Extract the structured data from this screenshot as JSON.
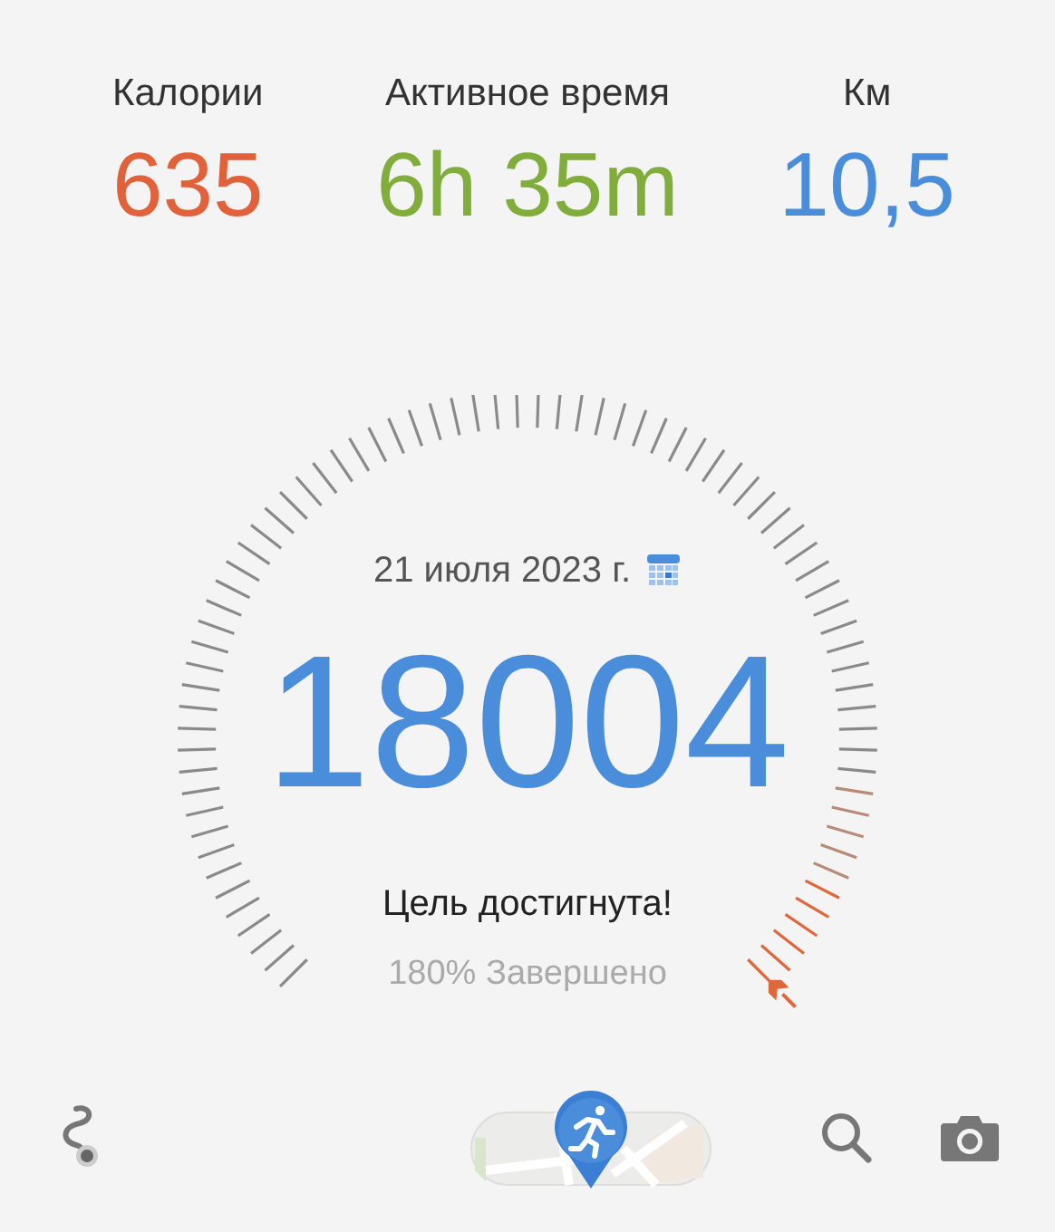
{
  "stats": [
    {
      "label": "Калории",
      "value": "635",
      "color": "#e1613b"
    },
    {
      "label": "Активное время",
      "value": "6h 35m",
      "color": "#80ad3c"
    },
    {
      "label": "Км",
      "value": "10,5",
      "color": "#4a8ddb"
    }
  ],
  "gauge": {
    "date": "21 июля 2023 г.",
    "steps": "18004",
    "status": "Цель достигнута!",
    "progress": "180% Завершено"
  },
  "toolbar": [
    {
      "kind": "route"
    },
    {
      "kind": "map"
    },
    {
      "kind": "search"
    },
    {
      "kind": "camera"
    }
  ]
}
